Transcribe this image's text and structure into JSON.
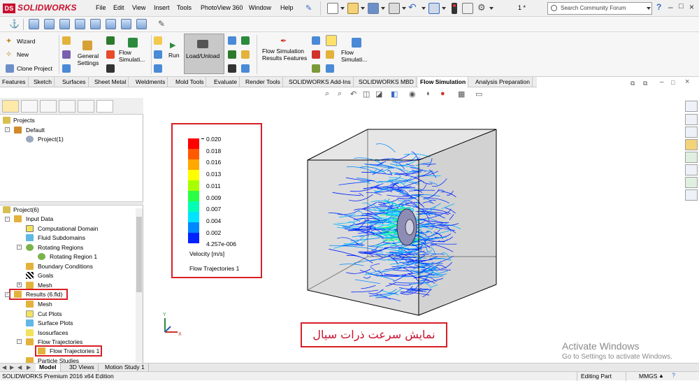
{
  "app": {
    "logo": "SOLIDWORKS",
    "logo_mark": "DS"
  },
  "menu": [
    "File",
    "Edit",
    "View",
    "Insert",
    "Tools",
    "PhotoView 360",
    "Window",
    "Help"
  ],
  "titlebar": {
    "doc_indicator": "1 *",
    "search_placeholder": "Search Community Forum",
    "help": "?",
    "minimize": "–",
    "maximize": "□",
    "close": "×"
  },
  "ribbon": {
    "wizard": "Wizard",
    "new": "New",
    "clone_project": "Clone Project",
    "general_settings": "General Settings",
    "flow_simulation_1": "Flow Simulati...",
    "run": "Run",
    "load_unload": "Load/Unload",
    "flow_results_features": "Flow Simulation Results Features",
    "flow_simulation_2": "Flow Simulati..."
  },
  "tabs": [
    "Features",
    "Sketch",
    "Surfaces",
    "Sheet Metal",
    "Weldments",
    "Mold Tools",
    "Evaluate",
    "Render Tools",
    "SOLIDWORKS Add-Ins",
    "SOLIDWORKS MBD",
    "Flow Simulation",
    "Analysis Preparation"
  ],
  "active_tab": "Flow Simulation",
  "tree_top": {
    "projects": "Projects",
    "default": "Default",
    "project1": "Project(1)"
  },
  "tree_bottom": {
    "root": "Project(6)",
    "input_data": "Input Data",
    "computational_domain": "Computational Domain",
    "fluid_subdomains": "Fluid Subdomains",
    "rotating_regions": "Rotating Regions",
    "rotating_region_1": "Rotating Region 1",
    "boundary_conditions": "Boundary Conditions",
    "goals": "Goals",
    "mesh": "Mesh",
    "results": "Results (6.fld)",
    "results_mesh": "Mesh",
    "cut_plots": "Cut Plots",
    "surface_plots": "Surface Plots",
    "isosurfaces": "Isosurfaces",
    "flow_trajectories": "Flow Trajectories",
    "flow_trajectories_1": "Flow Trajectories 1",
    "particle_studies": "Particle Studies"
  },
  "legend": {
    "values": [
      "0.020",
      "0.018",
      "0.016",
      "0.013",
      "0.011",
      "0.009",
      "0.007",
      "0.004",
      "0.002",
      "4.257e-006"
    ],
    "colors": [
      "#ff0000",
      "#ff5a00",
      "#ffa800",
      "#ffff00",
      "#a8ff00",
      "#2aff45",
      "#00ffb4",
      "#00e4ff",
      "#0089ff",
      "#0022ff"
    ],
    "quantity": "Velocity [m/s]",
    "name": "Flow Trajectories 1"
  },
  "caption": "نمایش سرعت ذرات سیال",
  "activate": {
    "line1": "Activate Windows",
    "line2": "Go to Settings to activate Windows."
  },
  "bottom_tabs": [
    "Model",
    "3D Views",
    "Motion Study 1"
  ],
  "status": {
    "edition": "SOLIDWORKS Premium 2016 x64 Edition",
    "mode": "Editing Part",
    "units": "MMGS"
  }
}
